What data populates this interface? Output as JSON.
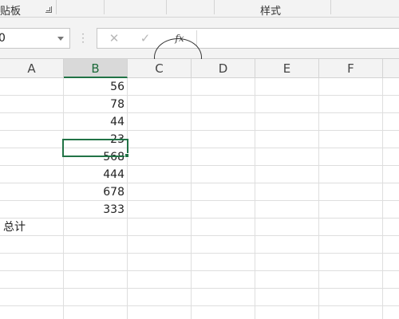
{
  "ribbon": {
    "clipboard_label": "贴板",
    "styles_label": "样式"
  },
  "formula_bar": {
    "name_box_value": "0",
    "cancel_glyph": "✕",
    "enter_glyph": "✓",
    "fx_label": "fx",
    "formula_value": ""
  },
  "columns": [
    "A",
    "B",
    "C",
    "D",
    "E",
    "F"
  ],
  "active_column": "B",
  "cells": {
    "column_B": [
      "56",
      "78",
      "44",
      "23",
      "568",
      "444",
      "678",
      "333"
    ],
    "row9_A_label": "总计",
    "selected_cell_value": ""
  },
  "colors": {
    "accent_green": "#217346",
    "grid_line": "#dedede",
    "header_bg": "#f3f3f3"
  }
}
